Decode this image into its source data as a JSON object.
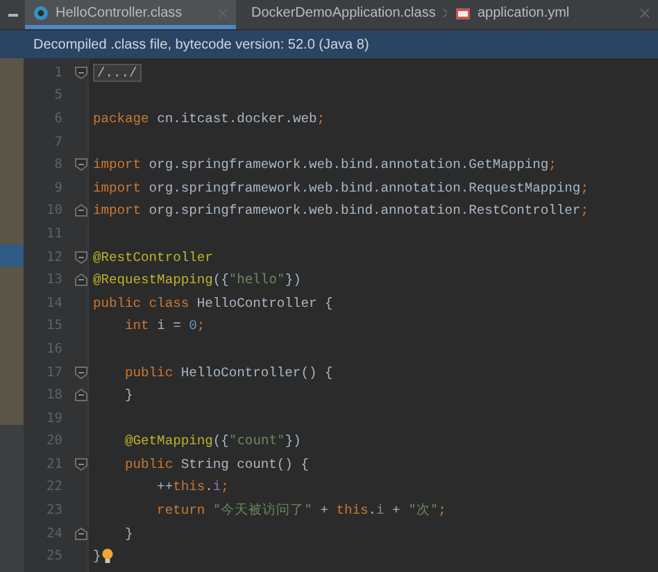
{
  "tabs": [
    {
      "label": "HelloController.class",
      "kind": "class",
      "selected": true
    },
    {
      "label": "DockerDemoApplication.class",
      "kind": "class",
      "selected": false
    },
    {
      "label": "application.yml",
      "kind": "yml",
      "selected": false
    }
  ],
  "info_bar": {
    "text": "Decompiled .class file, bytecode version: 52.0 (Java 8)"
  },
  "side_panel": {
    "highlight": true
  },
  "lines": [
    {
      "number": "1",
      "kind": "fold_start",
      "tokens": [
        {
          "kind": "folded",
          "text": "/.../"
        }
      ]
    },
    {
      "number": "5",
      "kind": "plain"
    },
    {
      "number": "6",
      "kind": "plain",
      "tokens": [
        {
          "kind": "kw",
          "text": "package"
        },
        {
          "kind": "plain",
          "text": " cn.itcast.docker.web"
        },
        {
          "kind": "kw",
          "text": ";"
        }
      ]
    },
    {
      "number": "7",
      "kind": "plain"
    },
    {
      "number": "8",
      "kind": "fold_start",
      "tokens": [
        {
          "kind": "kw",
          "text": "import"
        },
        {
          "kind": "plain",
          "text": " org.springframework.web.bind.annotation.GetMapping"
        },
        {
          "kind": "kw",
          "text": ";"
        }
      ]
    },
    {
      "number": "9",
      "kind": "plain",
      "tokens": [
        {
          "kind": "kw",
          "text": "import"
        },
        {
          "kind": "plain",
          "text": " org.springframework.web.bind.annotation.RequestMapping"
        },
        {
          "kind": "kw",
          "text": ";"
        }
      ]
    },
    {
      "number": "10",
      "kind": "fold_end",
      "tokens": [
        {
          "kind": "kw",
          "text": "import"
        },
        {
          "kind": "plain",
          "text": " org.springframework.web.bind.annotation.RestController"
        },
        {
          "kind": "kw",
          "text": ";"
        }
      ]
    },
    {
      "number": "11",
      "kind": "plain"
    },
    {
      "number": "12",
      "kind": "fold_start",
      "tokens": [
        {
          "kind": "ann",
          "text": "@RestController"
        }
      ]
    },
    {
      "number": "13",
      "kind": "fold_end",
      "tokens": [
        {
          "kind": "ann",
          "text": "@RequestMapping"
        },
        {
          "kind": "plain",
          "text": "({"
        },
        {
          "kind": "str",
          "text": "\"hello\""
        },
        {
          "kind": "plain",
          "text": "})"
        }
      ]
    },
    {
      "number": "14",
      "kind": "plain",
      "tokens": [
        {
          "kind": "kw",
          "text": "public class"
        },
        {
          "kind": "plain",
          "text": " HelloController {"
        }
      ]
    },
    {
      "number": "15",
      "kind": "plain",
      "tokens": [
        {
          "kind": "kw",
          "text": "    int"
        },
        {
          "kind": "plain",
          "text": " i = "
        },
        {
          "kind": "num",
          "text": "0"
        },
        {
          "kind": "kw",
          "text": ";"
        }
      ]
    },
    {
      "number": "16",
      "kind": "plain"
    },
    {
      "number": "17",
      "kind": "fold_start",
      "tokens": [
        {
          "kind": "kw",
          "text": "    public"
        },
        {
          "kind": "plain",
          "text": " HelloController() {"
        }
      ]
    },
    {
      "number": "18",
      "kind": "fold_end",
      "tokens": [
        {
          "kind": "plain",
          "text": "    }"
        }
      ]
    },
    {
      "number": "19",
      "kind": "plain"
    },
    {
      "number": "20",
      "kind": "plain",
      "tokens": [
        {
          "kind": "ann",
          "text": "    @GetMapping"
        },
        {
          "kind": "plain",
          "text": "({"
        },
        {
          "kind": "str",
          "text": "\"count\""
        },
        {
          "kind": "plain",
          "text": "})"
        }
      ]
    },
    {
      "number": "21",
      "kind": "fold_start",
      "tokens": [
        {
          "kind": "kw",
          "text": "    public"
        },
        {
          "kind": "plain",
          "text": " String count() {"
        }
      ]
    },
    {
      "number": "22",
      "kind": "plain",
      "tokens": [
        {
          "kind": "plain",
          "text": "        ++"
        },
        {
          "kind": "kw",
          "text": "this"
        },
        {
          "kind": "plain",
          "text": "."
        },
        {
          "kind": "field",
          "text": "i"
        },
        {
          "kind": "kw",
          "text": ";"
        }
      ]
    },
    {
      "number": "23",
      "kind": "plain",
      "tokens": [
        {
          "kind": "kw",
          "text": "        return"
        },
        {
          "kind": "str",
          "text": " \"今天被访问了\""
        },
        {
          "kind": "plain",
          "text": " + "
        },
        {
          "kind": "kw",
          "text": "this"
        },
        {
          "kind": "plain",
          "text": "."
        },
        {
          "kind": "field",
          "text": "i"
        },
        {
          "kind": "plain",
          "text": " + "
        },
        {
          "kind": "str",
          "text": "\"次\""
        },
        {
          "kind": "kw",
          "text": ";"
        }
      ]
    },
    {
      "number": "24",
      "kind": "fold_end",
      "tokens": [
        {
          "kind": "plain",
          "text": "    }"
        }
      ]
    },
    {
      "number": "25",
      "kind": "plain",
      "bulb": true,
      "tokens": [
        {
          "kind": "plain",
          "text": "}"
        }
      ]
    }
  ]
}
